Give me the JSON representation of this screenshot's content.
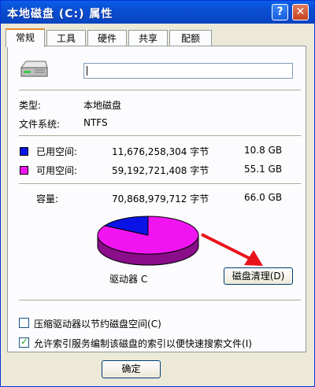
{
  "window": {
    "title": "本地磁盘 (C:) 属性"
  },
  "titlebar": {
    "help": "?",
    "close": "✕"
  },
  "tabs": [
    "常规",
    "工具",
    "硬件",
    "共享",
    "配额"
  ],
  "drive": {
    "name_value": "",
    "type_label": "类型:",
    "type_value": "本地磁盘",
    "fs_label": "文件系统:",
    "fs_value": "NTFS"
  },
  "space": {
    "used": {
      "label": "已用空间:",
      "bytes": "11,676,258,304 字节",
      "size": "10.8 GB",
      "color": "#0a14e6"
    },
    "free": {
      "label": "可用空间:",
      "bytes": "59,192,721,408 字节",
      "size": "55.1 GB",
      "color": "#f014f0"
    },
    "capacity": {
      "label": "容量:",
      "bytes": "70,868,979,712 字节",
      "size": "66.0 GB"
    }
  },
  "pie_fraction_used": 0.165,
  "drive_label": "驱动器 C",
  "cleanup_button": {
    "text": "磁盘清理",
    "accel": "(D)"
  },
  "compress_option": {
    "text": "压缩驱动器以节约磁盘空间",
    "accel": "(C)",
    "checked": false
  },
  "index_option": {
    "text": "允许索引服务编制该磁盘的索引以便快速搜索文件",
    "accel": "(I)",
    "checked": true
  },
  "ok_button": "确定"
}
